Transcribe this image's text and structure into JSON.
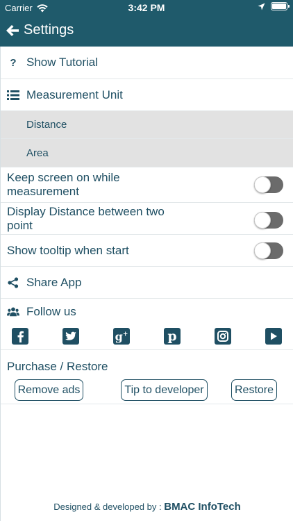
{
  "status": {
    "carrier": "Carrier",
    "time": "3:42 PM"
  },
  "header": {
    "title": "Settings"
  },
  "menu": {
    "tutorial": "Show Tutorial",
    "unit": "Measurement Unit",
    "unit_options": [
      "Distance",
      "Area"
    ],
    "keep_screen": "Keep screen on while measurement",
    "display_distance": "Display Distance between two point",
    "tooltip": "Show tooltip when start",
    "share": "Share App",
    "follow": "Follow us"
  },
  "toggles": {
    "keep_screen": false,
    "display_distance": false,
    "tooltip": false
  },
  "social": [
    "facebook",
    "twitter",
    "google-plus",
    "pinterest",
    "instagram",
    "youtube"
  ],
  "purchase": {
    "title": "Purchase / Restore",
    "buttons": [
      "Remove ads",
      "Tip to developer",
      "Restore"
    ]
  },
  "footer": {
    "prefix": "Designed & developed by :",
    "brand": "BMAC InfoTech"
  },
  "colors": {
    "accent": "#1f5a6b",
    "text": "#1f4f63",
    "subrow_bg": "#e2e2e2",
    "toggle_off": "#6b6b6b"
  }
}
